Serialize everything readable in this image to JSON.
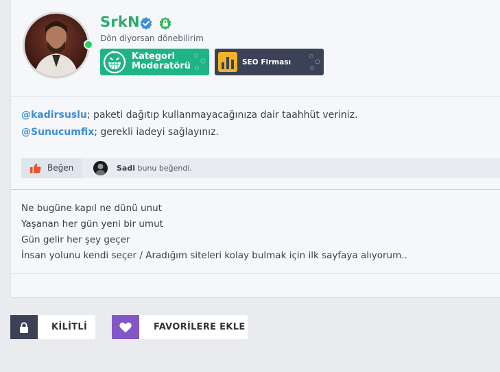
{
  "user": {
    "name": "SrkN",
    "status_text": "Dön diyorsan dönebilirim",
    "online": true
  },
  "banners": [
    {
      "label_line1": "Kategori",
      "label_line2": "Moderatörü",
      "icon": "grin-icon",
      "color": "#1fb486"
    },
    {
      "label": "SEO Firması",
      "icon": "bar-chart-icon",
      "color": "#3b4257"
    }
  ],
  "message": {
    "line1": {
      "mention": "@kadirsuslu",
      "text": "; paketi dağıtıp kullanmayacağınıza dair taahhüt veriniz."
    },
    "line2": {
      "mention": "@Sunucumfix",
      "text": "; gerekli iadeyi sağlayınız."
    }
  },
  "likes": {
    "button_label": "Beğen",
    "liker_name": "Sadi",
    "liker_suffix": " bunu beğendi."
  },
  "signature": {
    "lines": [
      "Ne bugüne kapıl ne dünü unut",
      "Yaşanan her gün yeni bir umut",
      "Gün gelir her şey geçer",
      "İnsan yolunu kendi seçer / Aradığım siteleri kolay bulmak için ilk sayfaya alıyorum.."
    ]
  },
  "actions": {
    "lock_label": "KİLİTLİ",
    "favorite_label": "FAVORİLERE EKLE"
  },
  "colors": {
    "username": "#2daa6e",
    "mention": "#3c8fd6",
    "online": "#22d35a",
    "lock_icon_bg": "#3b4255",
    "fav_icon_bg": "#8357c8"
  }
}
